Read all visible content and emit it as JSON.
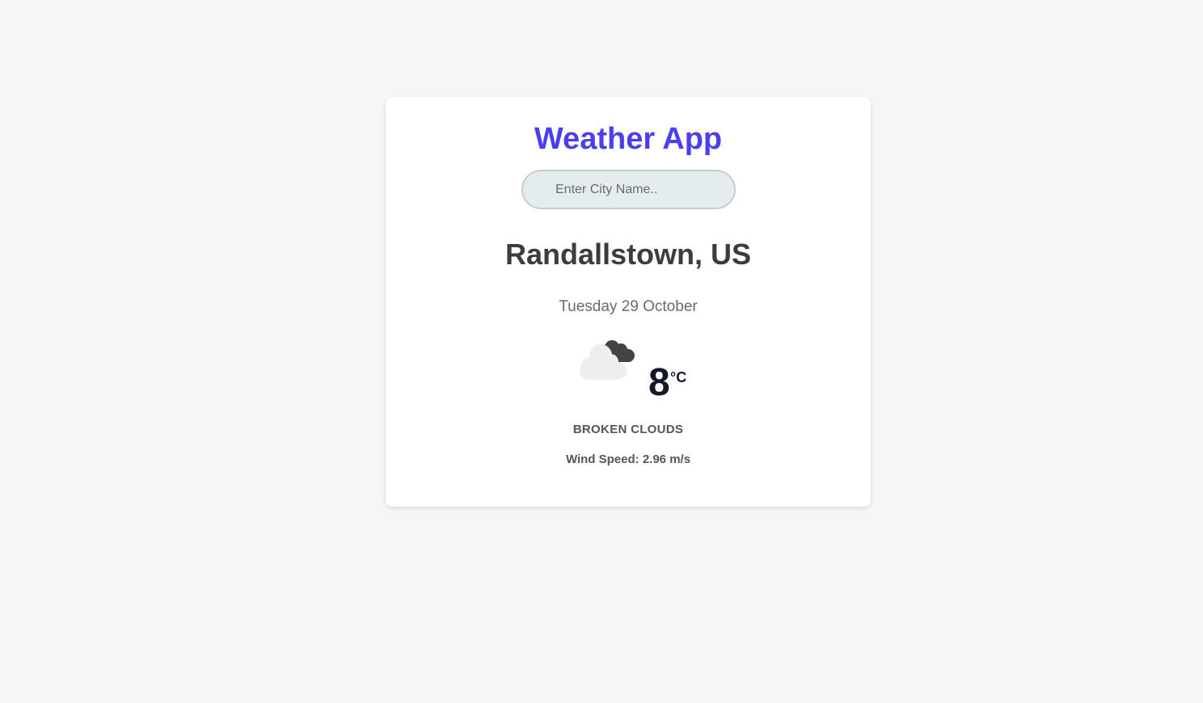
{
  "app": {
    "title": "Weather App"
  },
  "search": {
    "placeholder": "Enter City Name..",
    "value": ""
  },
  "weather": {
    "location": "Randallstown, US",
    "date": "Tuesday 29 October",
    "icon": "broken-clouds-icon",
    "temperature": "8",
    "unit": "°C",
    "description": "BROKEN CLOUDS",
    "wind_label": "Wind Speed:",
    "wind_value": "2.96 m/s"
  },
  "colors": {
    "background": "#f6f6f6",
    "card": "#ffffff",
    "title": "#4a3ff0",
    "input_bg": "#e5ecef",
    "text_dark": "#3c3c3c",
    "text_muted": "#6b6b6b"
  }
}
